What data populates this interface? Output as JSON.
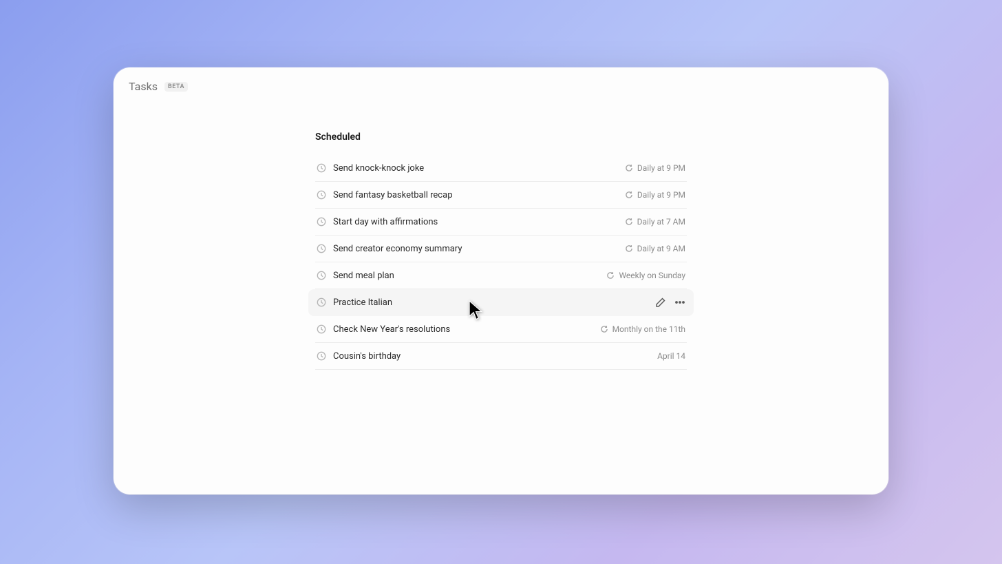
{
  "header": {
    "title": "Tasks",
    "badge": "BETA"
  },
  "section_heading": "Scheduled",
  "tasks": [
    {
      "title": "Send knock-knock joke",
      "schedule": "Daily at 9 PM",
      "recurring": true,
      "hovered": false
    },
    {
      "title": "Send fantasy basketball recap",
      "schedule": "Daily at 9 PM",
      "recurring": true,
      "hovered": false
    },
    {
      "title": "Start day with affirmations",
      "schedule": "Daily at 7 AM",
      "recurring": true,
      "hovered": false
    },
    {
      "title": "Send creator economy summary",
      "schedule": "Daily at 9 AM",
      "recurring": true,
      "hovered": false
    },
    {
      "title": "Send meal plan",
      "schedule": "Weekly on Sunday",
      "recurring": true,
      "hovered": false
    },
    {
      "title": "Practice Italian",
      "schedule": "",
      "recurring": false,
      "hovered": true
    },
    {
      "title": "Check New Year's resolutions",
      "schedule": "Monthly on the 11th",
      "recurring": true,
      "hovered": false
    },
    {
      "title": "Cousin's birthday",
      "schedule": "April 14",
      "recurring": false,
      "hovered": false
    }
  ]
}
